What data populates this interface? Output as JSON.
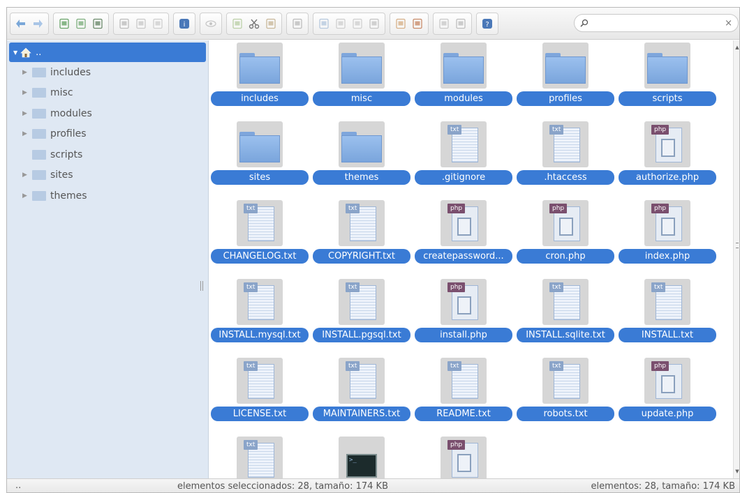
{
  "toolbar": {
    "groups": [
      [
        "back-icon",
        "forward-icon"
      ],
      [
        "home-icon",
        "reload-icon",
        "save-icon"
      ],
      [
        "copy-doc-icon",
        "floppy-icon",
        "cursor-icon"
      ],
      [
        "info-icon"
      ],
      [
        "eye-icon"
      ],
      [
        "duplicate-icon",
        "cut-icon",
        "paste-icon"
      ],
      [
        "trash-icon"
      ],
      [
        "edit-icon",
        "extract-icon",
        "archive-icon",
        "resize-icon"
      ],
      [
        "list-icon",
        "grid-icon"
      ],
      [
        "view-icon",
        "columns-icon"
      ],
      [
        "help-icon"
      ]
    ],
    "search_placeholder": "",
    "clear_symbol": "×"
  },
  "sidebar": {
    "root_label": "..",
    "items": [
      {
        "label": "includes",
        "expandable": true
      },
      {
        "label": "misc",
        "expandable": true
      },
      {
        "label": "modules",
        "expandable": true
      },
      {
        "label": "profiles",
        "expandable": true
      },
      {
        "label": "scripts",
        "expandable": false
      },
      {
        "label": "sites",
        "expandable": true
      },
      {
        "label": "themes",
        "expandable": true
      }
    ]
  },
  "files": [
    {
      "name": "includes",
      "kind": "folder"
    },
    {
      "name": "misc",
      "kind": "folder"
    },
    {
      "name": "modules",
      "kind": "folder"
    },
    {
      "name": "profiles",
      "kind": "folder"
    },
    {
      "name": "scripts",
      "kind": "folder"
    },
    {
      "name": "sites",
      "kind": "folder"
    },
    {
      "name": "themes",
      "kind": "folder"
    },
    {
      "name": ".gitignore",
      "kind": "txt"
    },
    {
      "name": ".htaccess",
      "kind": "txt"
    },
    {
      "name": "authorize.php",
      "kind": "php"
    },
    {
      "name": "CHANGELOG.txt",
      "kind": "txt"
    },
    {
      "name": "COPYRIGHT.txt",
      "kind": "txt"
    },
    {
      "name": "createpassword...",
      "kind": "php"
    },
    {
      "name": "cron.php",
      "kind": "php"
    },
    {
      "name": "index.php",
      "kind": "php"
    },
    {
      "name": "INSTALL.mysql.txt",
      "kind": "txt"
    },
    {
      "name": "INSTALL.pgsql.txt",
      "kind": "txt"
    },
    {
      "name": "install.php",
      "kind": "php"
    },
    {
      "name": "INSTALL.sqlite.txt",
      "kind": "txt"
    },
    {
      "name": "INSTALL.txt",
      "kind": "txt"
    },
    {
      "name": "LICENSE.txt",
      "kind": "txt"
    },
    {
      "name": "MAINTAINERS.txt",
      "kind": "txt"
    },
    {
      "name": "README.txt",
      "kind": "txt"
    },
    {
      "name": "robots.txt",
      "kind": "txt"
    },
    {
      "name": "update.php",
      "kind": "php"
    },
    {
      "name": "",
      "kind": "txt"
    },
    {
      "name": "",
      "kind": "terminal"
    },
    {
      "name": "",
      "kind": "php"
    }
  ],
  "badges": {
    "txt": "txt",
    "php": "php"
  },
  "status": {
    "path": "..",
    "selected": "elementos seleccionados: 28, tamaño: 174 KB",
    "total": "elementos: 28, tamaño: 174 KB"
  },
  "colors": {
    "accent": "#3a7bd5",
    "sidebar_bg": "#dfe8f3",
    "thumb_bg": "#d6d6d6"
  }
}
